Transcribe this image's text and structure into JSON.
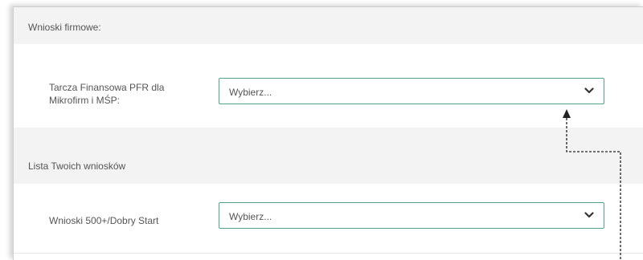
{
  "section1": {
    "header": "Wnioski firmowe:",
    "row_label": "Tarcza Finansowa PFR dla Mikrofirm i MŚP:",
    "select_value": "Wybierz..."
  },
  "section2": {
    "header": "Lista Twoich wniosków",
    "row_label": "Wnioski 500+/Dobry Start",
    "select_value": "Wybierz..."
  },
  "colors": {
    "accent": "#4fa38a",
    "header_bg": "#f3f3f3",
    "text": "#555555"
  },
  "icons": [
    "chevron-down-icon",
    "arrow-up-icon"
  ]
}
